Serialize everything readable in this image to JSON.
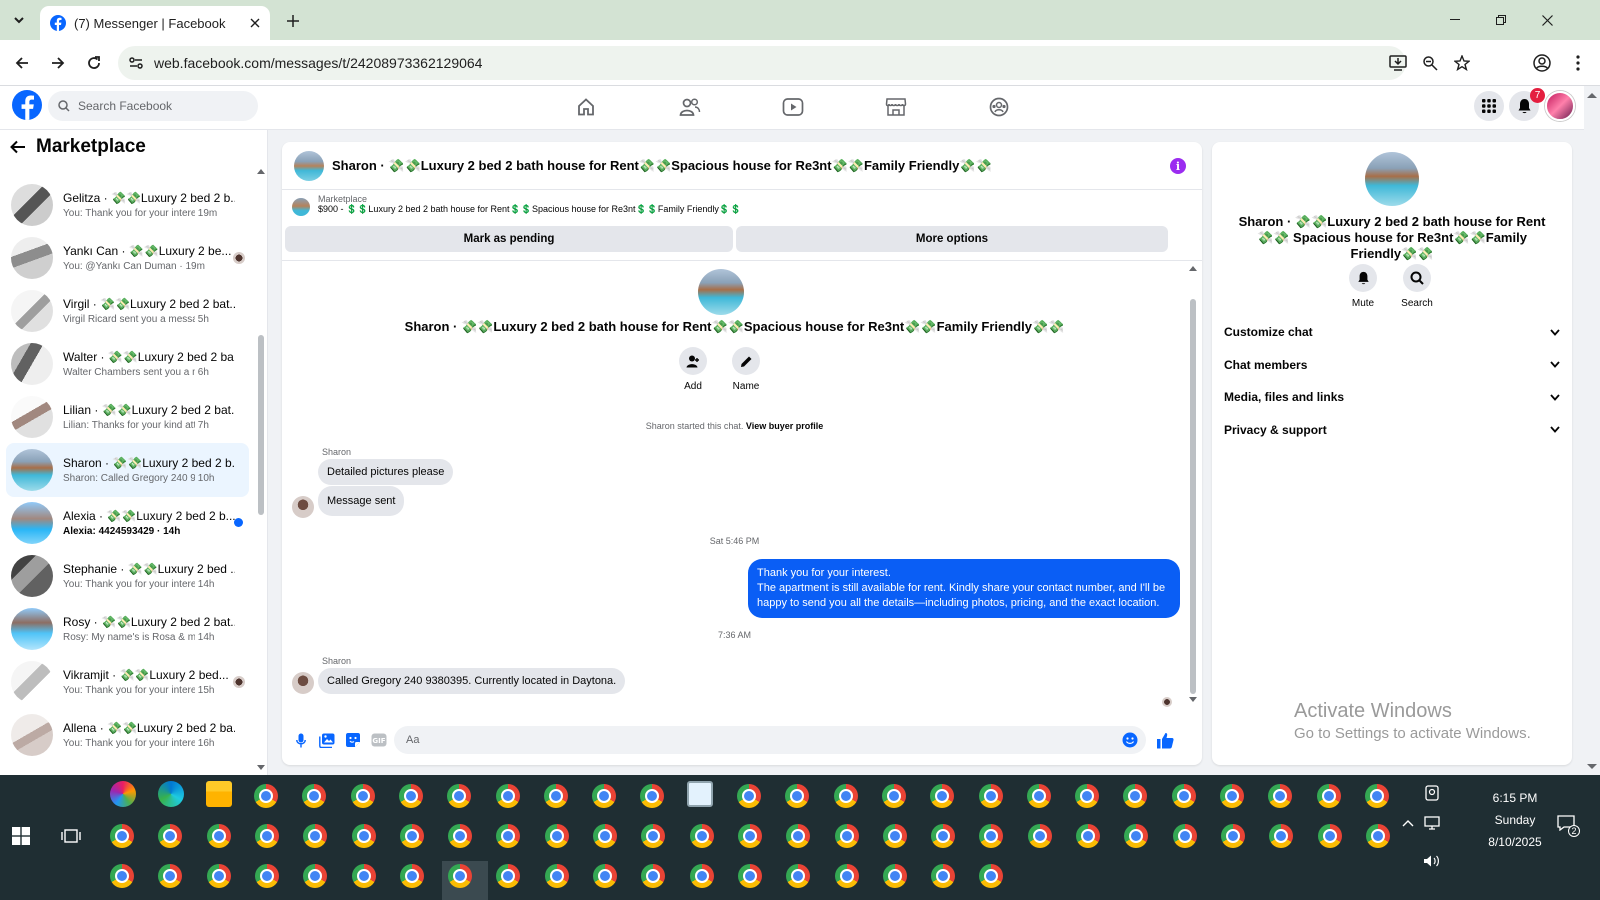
{
  "browser": {
    "tab_title": "(7) Messenger | Facebook",
    "url": "web.facebook.com/messages/t/24208973362129064"
  },
  "facebook": {
    "search_placeholder": "Search Facebook",
    "notifications_count": "7",
    "nav_icons": [
      "home-icon",
      "friends-icon",
      "video-icon",
      "marketplace-icon",
      "groups-icon"
    ]
  },
  "sidebar": {
    "title": "Marketplace",
    "conversations": [
      {
        "name": "Gelitza · 💸💸Luxury 2 bed 2 b...",
        "preview": "You: Thank you for your interest....",
        "time": "19m",
        "unread": false,
        "indicator": ""
      },
      {
        "name": "Yankı Can · 💸💸Luxury 2 be...",
        "preview": "You: @Yankı Can Duman ·",
        "time": "19m",
        "unread": false,
        "indicator": "avatar"
      },
      {
        "name": "Virgil · 💸💸Luxury 2 bed 2 bat...",
        "preview": "Virgil Ricard sent you a message a...",
        "time": "5h",
        "unread": false,
        "indicator": ""
      },
      {
        "name": "Walter · 💸💸Luxury 2 bed 2 ba...",
        "preview": "Walter Chambers sent you a mess...",
        "time": "6h",
        "unread": false,
        "indicator": ""
      },
      {
        "name": "Lilian · 💸💸Luxury 2 bed 2 bat...",
        "preview": "Lilian: Thanks for your kind attenti...",
        "time": "7h",
        "unread": false,
        "indicator": ""
      },
      {
        "name": "Sharon · 💸💸Luxury 2 bed 2 b...",
        "preview": "Sharon: Called Gregory 240 9380...",
        "time": "10h",
        "unread": false,
        "indicator": "",
        "active": true
      },
      {
        "name": "Alexia · 💸💸Luxury 2 bed 2 b...",
        "preview": "Alexia: 4424593429 ·",
        "time": "14h",
        "unread": true,
        "indicator": "dot"
      },
      {
        "name": "Stephanie · 💸💸Luxury 2 bed ...",
        "preview": "You: Thank you for your interest. ...",
        "time": "14h",
        "unread": false,
        "indicator": ""
      },
      {
        "name": "Rosy · 💸💸Luxury 2 bed 2 bat...",
        "preview": "Rosy: My name's is Rosa & my co...",
        "time": "14h",
        "unread": false,
        "indicator": ""
      },
      {
        "name": "Vikramjit · 💸💸Luxury 2 bed...",
        "preview": "You: Thank you for your intere...",
        "time": "15h",
        "unread": false,
        "indicator": "avatar"
      },
      {
        "name": "Allena · 💸💸Luxury 2 bed 2 ba...",
        "preview": "You: Thank you for your interest. ...",
        "time": "16h",
        "unread": false,
        "indicator": ""
      }
    ]
  },
  "chat": {
    "header_title": "Sharon · 💸💸Luxury 2 bed 2 bath house for Rent💸💸Spacious house for Re3nt💸💸Family Friendly💸💸",
    "marketplace_label": "Marketplace",
    "listing_line": "$900 - 💲💲Luxury 2 bed 2 bath house for Rent💲💲Spacious house for Re3nt💲💲Family Friendly💲💲",
    "mark_pending": "Mark as pending",
    "more_options": "More options",
    "intro_title": "Sharon · 💸💸Luxury 2 bed 2 bath house for Rent💸💸Spacious house for Re3nt💸💸Family Friendly💸💸",
    "add_label": "Add",
    "name_label": "Name",
    "started_text": "Sharon started this chat.",
    "view_buyer": "View buyer profile",
    "sender1": "Sharon",
    "msg1": "Detailed pictures please",
    "msg2": "Message sent",
    "time1": "Sat 5:46 PM",
    "out_line1": "Thank you for your interest.",
    "out_line2": "The apartment is still available for rent. Kindly share your contact number, and I'll be happy to send you all the details—including photos, pricing, and the exact location.",
    "time2": "7:36 AM",
    "sender2": "Sharon",
    "msg3": "Called Gregory 240 9380395. Currently located in Daytona.",
    "compose_placeholder": "Aa"
  },
  "details": {
    "title": "Sharon · 💸💸Luxury 2 bed 2 bath house for Rent💸💸 Spacious house for Re3nt💸💸Family Friendly💸💸",
    "mute": "Mute",
    "search": "Search",
    "sections": [
      "Customize chat",
      "Chat members",
      "Media, files and links",
      "Privacy & support"
    ],
    "activate_line1": "Activate Windows",
    "activate_line2": "Go to Settings to activate Windows."
  },
  "taskbar": {
    "time": "6:15 PM",
    "day": "Sunday",
    "date": "8/10/2025",
    "notif_count": "2"
  },
  "colors": {
    "fb_blue": "#0866ff",
    "bubble_out": "#0a5ef5",
    "chrome_green": "#d3e3d3",
    "taskbar": "#1f2e33"
  }
}
